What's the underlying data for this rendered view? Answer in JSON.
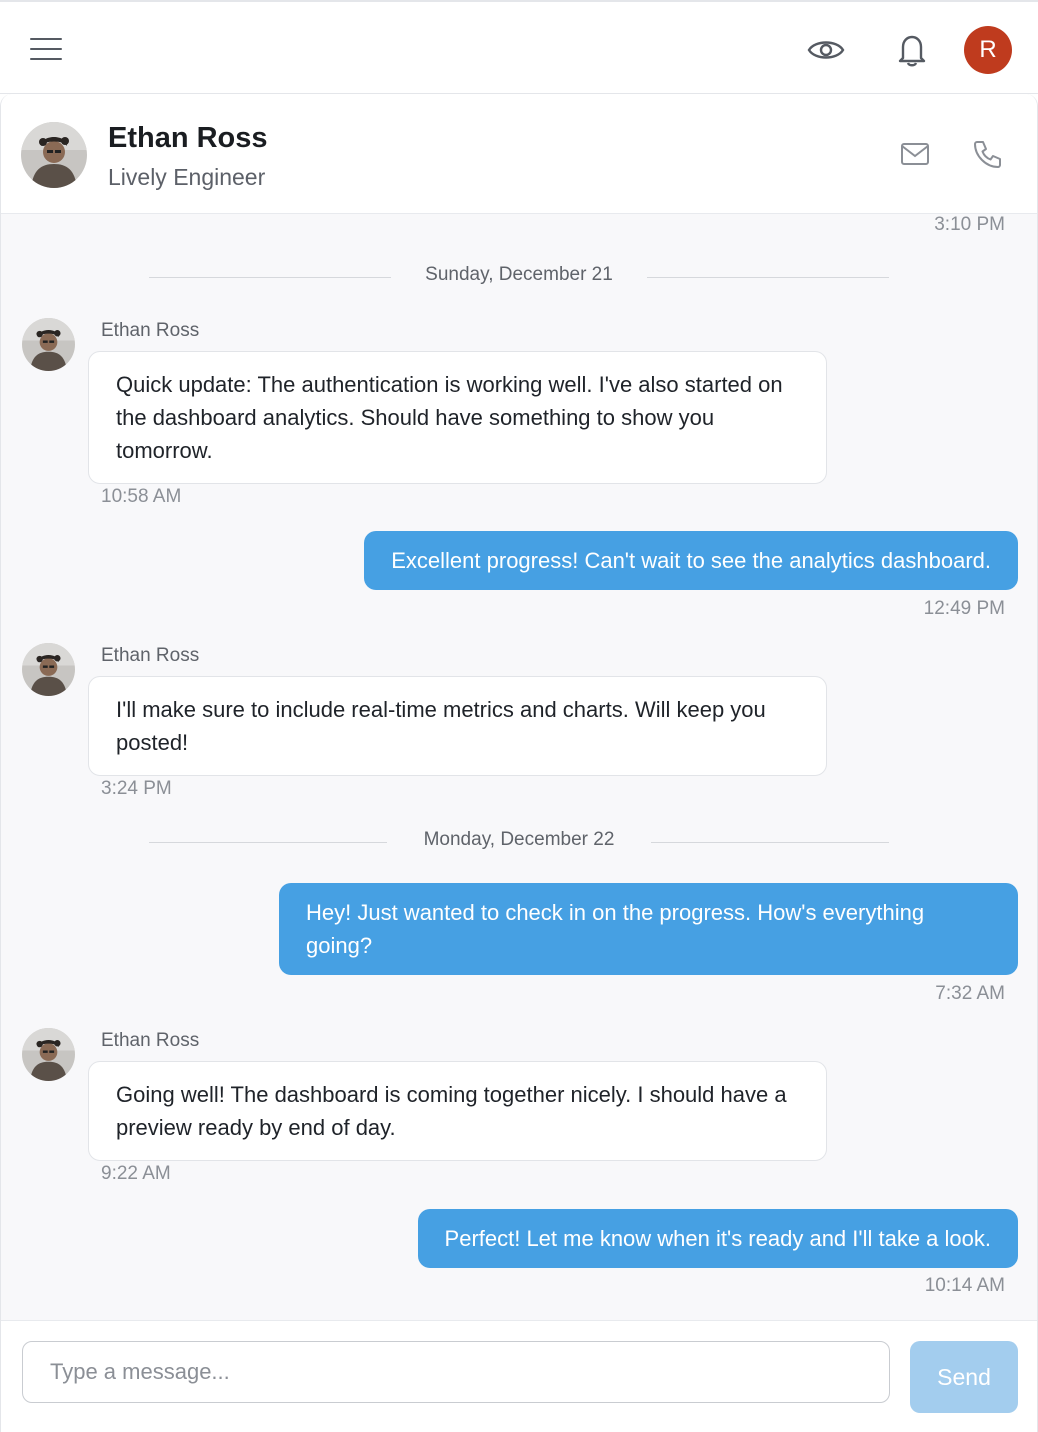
{
  "topbar": {
    "menu_icon": "hamburger-menu-icon",
    "view_icon": "eye-icon",
    "notification_icon": "bell-icon",
    "user_initial": "R",
    "user_avatar_color": "#bf3b1e"
  },
  "contact": {
    "name": "Ethan Ross",
    "role": "Lively Engineer",
    "email_icon": "mail-icon",
    "phone_icon": "phone-icon"
  },
  "messages": {
    "prev_time": "3:10 PM",
    "day1": "Sunday, December 21",
    "m1_sender": "Ethan Ross",
    "m1_text": "Quick update: The authentication is working well. I've also started on the dashboard analytics. Should have something to show you tomorrow.",
    "m1_time": "10:58 AM",
    "m2_text": "Excellent progress! Can't wait to see the analytics dashboard.",
    "m2_time": "12:49 PM",
    "m3_sender": "Ethan Ross",
    "m3_text": "I'll make sure to include real-time metrics and charts. Will keep you posted!",
    "m3_time": "3:24 PM",
    "day2": "Monday, December 22",
    "m4_text": "Hey! Just wanted to check in on the progress. How's everything going?",
    "m4_time": "7:32 AM",
    "m5_sender": "Ethan Ross",
    "m5_text": "Going well! The dashboard is coming together nicely. I should have a preview ready by end of day.",
    "m5_time": "9:22 AM",
    "m6_text": "Perfect! Let me know when it's ready and I'll take a look.",
    "m6_time": "10:14 AM"
  },
  "composer": {
    "placeholder": "Type a message...",
    "value": "",
    "send_label": "Send"
  },
  "colors": {
    "outgoing_bubble": "#46a0e3",
    "send_button": "#a3cdee",
    "chat_background": "#f8f8fa"
  }
}
